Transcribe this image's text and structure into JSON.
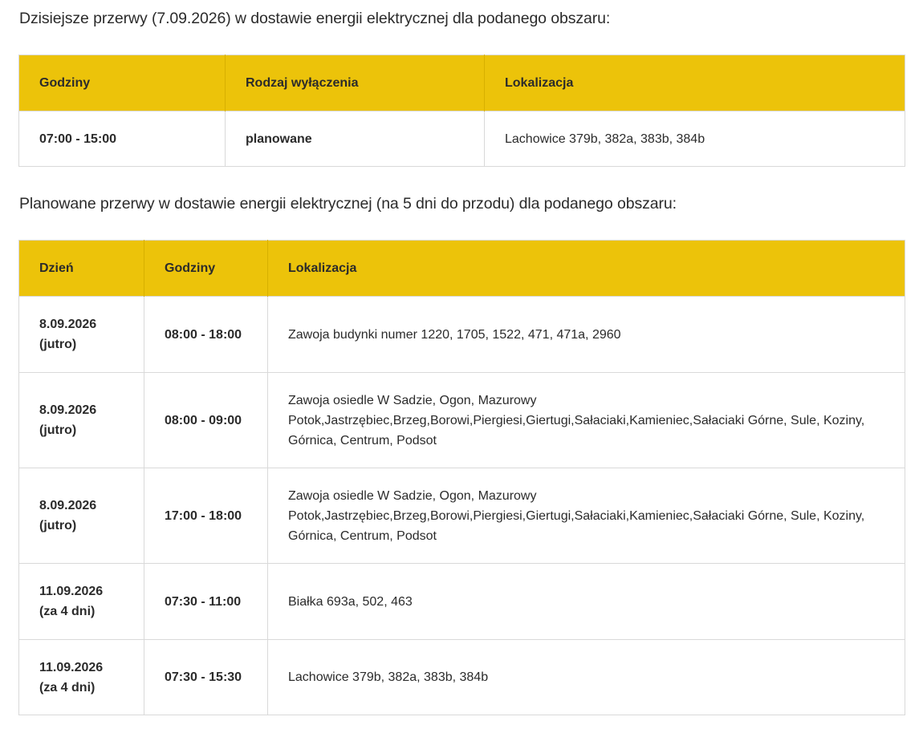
{
  "today": {
    "heading": "Dzisiejsze przerwy (7.09.2026) w dostawie energii elektrycznej dla podanego obszaru:",
    "columns": [
      "Godziny",
      "Rodzaj wyłączenia",
      "Lokalizacja"
    ],
    "rows": [
      {
        "hours": "07:00 - 15:00",
        "type": "planowane",
        "location": "Lachowice 379b, 382a, 383b, 384b"
      }
    ]
  },
  "planned": {
    "heading": "Planowane przerwy w dostawie energii elektrycznej (na 5 dni do przodu) dla podanego obszaru:",
    "columns": [
      "Dzień",
      "Godziny",
      "Lokalizacja"
    ],
    "rows": [
      {
        "date": "8.09.2026",
        "relative": "(jutro)",
        "hours": "08:00 - 18:00",
        "location_lines": [
          "Zawoja budynki numer 1220, 1705, 1522, 471, 471a, 2960"
        ]
      },
      {
        "date": "8.09.2026",
        "relative": "(jutro)",
        "hours": "08:00 - 09:00",
        "location_lines": [
          "Zawoja osiedle W Sadzie, Ogon, Mazurowy",
          "Potok,Jastrzębiec,Brzeg,Borowi,Piergiesi,Giertugi,Sałaciaki,Kamieniec,Sałaciaki Górne, Sule, Koziny,",
          "Górnica, Centrum, Podsot"
        ]
      },
      {
        "date": "8.09.2026",
        "relative": "(jutro)",
        "hours": "17:00 - 18:00",
        "location_lines": [
          "Zawoja osiedle W Sadzie, Ogon, Mazurowy",
          "Potok,Jastrzębiec,Brzeg,Borowi,Piergiesi,Giertugi,Sałaciaki,Kamieniec,Sałaciaki Górne, Sule, Koziny,",
          "Górnica, Centrum, Podsot"
        ]
      },
      {
        "date": "11.09.2026",
        "relative": "(za 4 dni)",
        "hours": "07:30 - 11:00",
        "location_lines": [
          "Białka 693a, 502, 463"
        ]
      },
      {
        "date": "11.09.2026",
        "relative": "(za 4 dni)",
        "hours": "07:30 - 15:30",
        "location_lines": [
          "Lachowice 379b, 382a, 383b, 384b"
        ]
      }
    ]
  },
  "colors": {
    "header_bg": "#ecc30a",
    "text": "#2b2b2b",
    "border": "#d9d9d9"
  }
}
